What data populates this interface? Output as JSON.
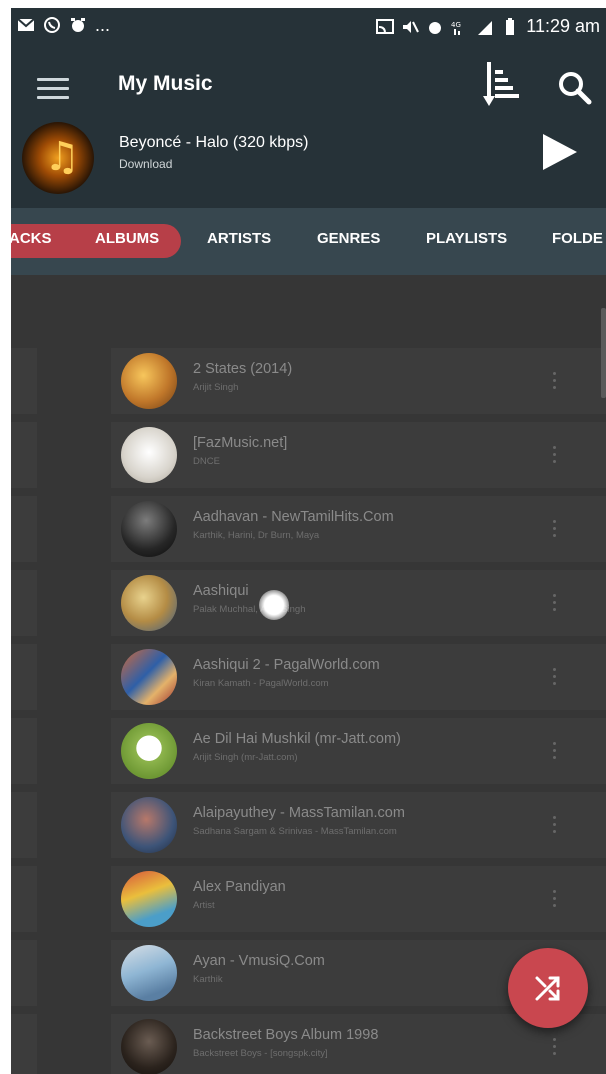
{
  "status_bar": {
    "time": "11:29 am",
    "overflow": "..."
  },
  "toolbar": {
    "title": "My Music",
    "menu_icon": "hamburger-menu-icon",
    "sort_icon": "sort-icon",
    "search_icon": "search-icon"
  },
  "now_playing": {
    "title": "Beyoncé - Halo (320  kbps)",
    "subtitle": "Download",
    "play_icon": "play-icon"
  },
  "tabs": [
    {
      "label": "ACKS"
    },
    {
      "label": "ALBUMS",
      "selected": true
    },
    {
      "label": "ARTISTS"
    },
    {
      "label": "GENRES"
    },
    {
      "label": "PLAYLISTS"
    },
    {
      "label": "FOLDE"
    }
  ],
  "albums": [
    {
      "name": "2 States (2014)",
      "artist": "Arijit Singh"
    },
    {
      "name": "[FazMusic.net]",
      "artist": "DNCE"
    },
    {
      "name": "Aadhavan - NewTamilHits.Com",
      "artist": "Karthik, Harini, Dr Burn, Maya"
    },
    {
      "name": "Aashiqui",
      "artist": "Palak Muchhal, Arijit Singh"
    },
    {
      "name": "Aashiqui 2 - PagalWorld.com",
      "artist": "Kiran Kamath - PagalWorld.com"
    },
    {
      "name": "Ae Dil Hai Mushkil (mr-Jatt.com)",
      "artist": "Arijit Singh (mr-Jatt.com)"
    },
    {
      "name": "Alaipayuthey - MassTamilan.com",
      "artist": "Sadhana Sargam & Srinivas - MassTamilan.com"
    },
    {
      "name": "Alex Pandiyan",
      "artist": "Artist"
    },
    {
      "name": "Ayan - VmusiQ.Com",
      "artist": "Karthik"
    },
    {
      "name": "Backstreet Boys Album 1998",
      "artist": "Backstreet Boys - [songspk.city]"
    }
  ],
  "fab": {
    "icon": "shuffle-icon"
  },
  "colors": {
    "accent": "#c9474f",
    "toolbar": "#263238",
    "tabs": "#37474f",
    "background": "#363636"
  }
}
